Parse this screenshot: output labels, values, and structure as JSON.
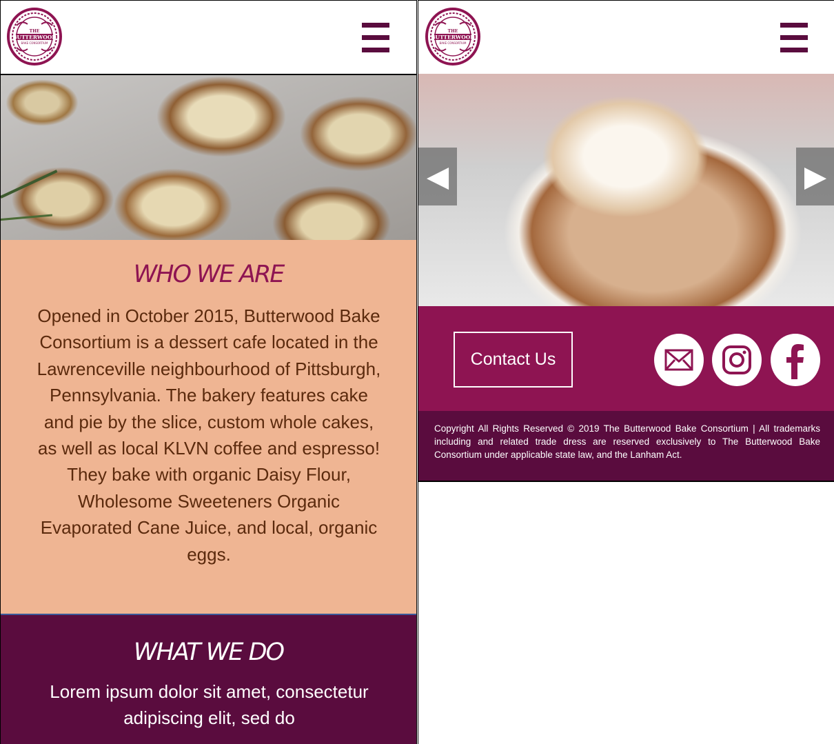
{
  "brand": {
    "logo_line1": "THE",
    "logo_line2": "BUTTERWOOD",
    "logo_line3": "BAKE CONSORTIUM",
    "primary_color": "#8e1452",
    "dark_color": "#5a0c3e",
    "peach_color": "#efb593"
  },
  "mobile_left": {
    "menu_icon": "hamburger-menu-icon",
    "who": {
      "heading": "WHO WE ARE",
      "body": "Opened in October 2015, Butterwood Bake Consortium is a dessert cafe located in the Lawrenceville neighbourhood of Pittsburgh, Pennsylvania. The bakery features cake and pie by the slice, custom whole cakes, as well as local KLVN coffee and espresso! They bake with organic Daisy Flour, Wholesome Sweeteners Organic Evaporated Cane Juice, and local, organic eggs."
    },
    "what": {
      "heading": "WHAT WE DO",
      "body": "Lorem ipsum dolor sit amet, consectetur adipiscing elit, sed do"
    }
  },
  "mobile_right": {
    "menu_icon": "hamburger-menu-icon",
    "carousel": {
      "prev_symbol": "◀",
      "next_symbol": "▶"
    },
    "contact_label": "Contact Us",
    "social_icons": [
      "mail-icon",
      "instagram-icon",
      "facebook-icon"
    ],
    "footer_text": "Copyright All Rights Reserved © 2019 The Butterwood Bake Consortium | All trademarks including and related trade dress are reserved exclusively to The Butterwood Bake Consortium under applicable state law, and the Lanham Act."
  }
}
